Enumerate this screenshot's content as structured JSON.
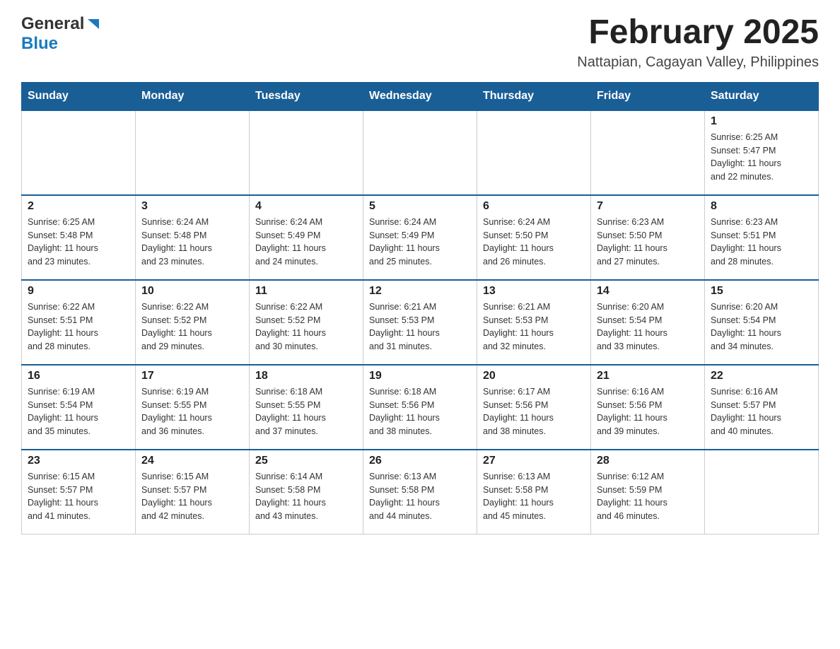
{
  "header": {
    "logo_general": "General",
    "logo_blue": "Blue",
    "title": "February 2025",
    "subtitle": "Nattapian, Cagayan Valley, Philippines"
  },
  "weekdays": [
    "Sunday",
    "Monday",
    "Tuesday",
    "Wednesday",
    "Thursday",
    "Friday",
    "Saturday"
  ],
  "weeks": [
    [
      {
        "day": "",
        "info": ""
      },
      {
        "day": "",
        "info": ""
      },
      {
        "day": "",
        "info": ""
      },
      {
        "day": "",
        "info": ""
      },
      {
        "day": "",
        "info": ""
      },
      {
        "day": "",
        "info": ""
      },
      {
        "day": "1",
        "info": "Sunrise: 6:25 AM\nSunset: 5:47 PM\nDaylight: 11 hours\nand 22 minutes."
      }
    ],
    [
      {
        "day": "2",
        "info": "Sunrise: 6:25 AM\nSunset: 5:48 PM\nDaylight: 11 hours\nand 23 minutes."
      },
      {
        "day": "3",
        "info": "Sunrise: 6:24 AM\nSunset: 5:48 PM\nDaylight: 11 hours\nand 23 minutes."
      },
      {
        "day": "4",
        "info": "Sunrise: 6:24 AM\nSunset: 5:49 PM\nDaylight: 11 hours\nand 24 minutes."
      },
      {
        "day": "5",
        "info": "Sunrise: 6:24 AM\nSunset: 5:49 PM\nDaylight: 11 hours\nand 25 minutes."
      },
      {
        "day": "6",
        "info": "Sunrise: 6:24 AM\nSunset: 5:50 PM\nDaylight: 11 hours\nand 26 minutes."
      },
      {
        "day": "7",
        "info": "Sunrise: 6:23 AM\nSunset: 5:50 PM\nDaylight: 11 hours\nand 27 minutes."
      },
      {
        "day": "8",
        "info": "Sunrise: 6:23 AM\nSunset: 5:51 PM\nDaylight: 11 hours\nand 28 minutes."
      }
    ],
    [
      {
        "day": "9",
        "info": "Sunrise: 6:22 AM\nSunset: 5:51 PM\nDaylight: 11 hours\nand 28 minutes."
      },
      {
        "day": "10",
        "info": "Sunrise: 6:22 AM\nSunset: 5:52 PM\nDaylight: 11 hours\nand 29 minutes."
      },
      {
        "day": "11",
        "info": "Sunrise: 6:22 AM\nSunset: 5:52 PM\nDaylight: 11 hours\nand 30 minutes."
      },
      {
        "day": "12",
        "info": "Sunrise: 6:21 AM\nSunset: 5:53 PM\nDaylight: 11 hours\nand 31 minutes."
      },
      {
        "day": "13",
        "info": "Sunrise: 6:21 AM\nSunset: 5:53 PM\nDaylight: 11 hours\nand 32 minutes."
      },
      {
        "day": "14",
        "info": "Sunrise: 6:20 AM\nSunset: 5:54 PM\nDaylight: 11 hours\nand 33 minutes."
      },
      {
        "day": "15",
        "info": "Sunrise: 6:20 AM\nSunset: 5:54 PM\nDaylight: 11 hours\nand 34 minutes."
      }
    ],
    [
      {
        "day": "16",
        "info": "Sunrise: 6:19 AM\nSunset: 5:54 PM\nDaylight: 11 hours\nand 35 minutes."
      },
      {
        "day": "17",
        "info": "Sunrise: 6:19 AM\nSunset: 5:55 PM\nDaylight: 11 hours\nand 36 minutes."
      },
      {
        "day": "18",
        "info": "Sunrise: 6:18 AM\nSunset: 5:55 PM\nDaylight: 11 hours\nand 37 minutes."
      },
      {
        "day": "19",
        "info": "Sunrise: 6:18 AM\nSunset: 5:56 PM\nDaylight: 11 hours\nand 38 minutes."
      },
      {
        "day": "20",
        "info": "Sunrise: 6:17 AM\nSunset: 5:56 PM\nDaylight: 11 hours\nand 38 minutes."
      },
      {
        "day": "21",
        "info": "Sunrise: 6:16 AM\nSunset: 5:56 PM\nDaylight: 11 hours\nand 39 minutes."
      },
      {
        "day": "22",
        "info": "Sunrise: 6:16 AM\nSunset: 5:57 PM\nDaylight: 11 hours\nand 40 minutes."
      }
    ],
    [
      {
        "day": "23",
        "info": "Sunrise: 6:15 AM\nSunset: 5:57 PM\nDaylight: 11 hours\nand 41 minutes."
      },
      {
        "day": "24",
        "info": "Sunrise: 6:15 AM\nSunset: 5:57 PM\nDaylight: 11 hours\nand 42 minutes."
      },
      {
        "day": "25",
        "info": "Sunrise: 6:14 AM\nSunset: 5:58 PM\nDaylight: 11 hours\nand 43 minutes."
      },
      {
        "day": "26",
        "info": "Sunrise: 6:13 AM\nSunset: 5:58 PM\nDaylight: 11 hours\nand 44 minutes."
      },
      {
        "day": "27",
        "info": "Sunrise: 6:13 AM\nSunset: 5:58 PM\nDaylight: 11 hours\nand 45 minutes."
      },
      {
        "day": "28",
        "info": "Sunrise: 6:12 AM\nSunset: 5:59 PM\nDaylight: 11 hours\nand 46 minutes."
      },
      {
        "day": "",
        "info": ""
      }
    ]
  ]
}
